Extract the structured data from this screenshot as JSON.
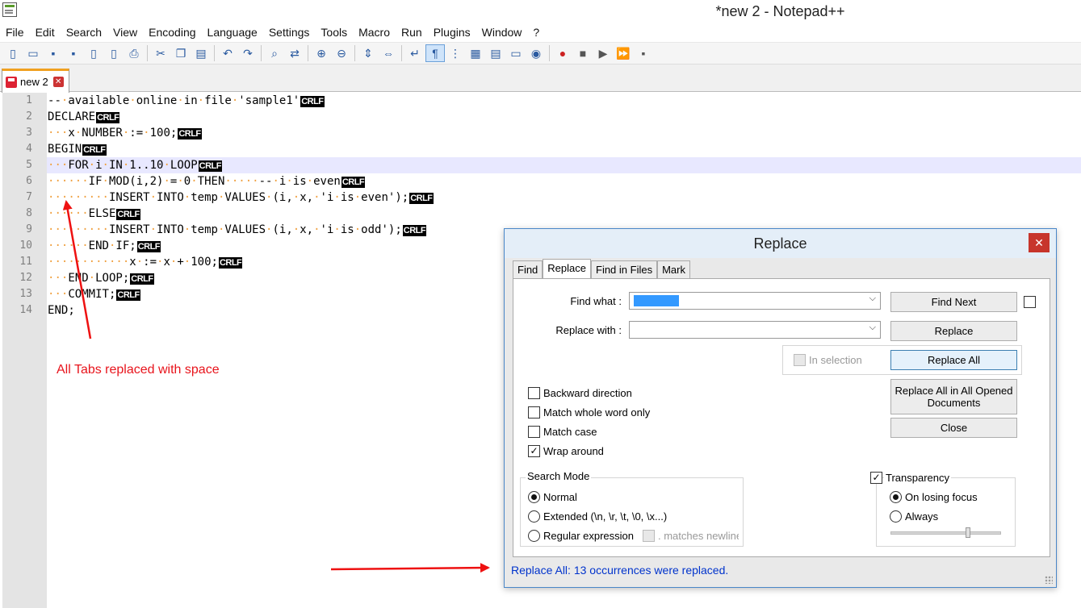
{
  "window": {
    "title": "*new 2 - Notepad++"
  },
  "menu": [
    "File",
    "Edit",
    "Search",
    "View",
    "Encoding",
    "Language",
    "Settings",
    "Tools",
    "Macro",
    "Run",
    "Plugins",
    "Window",
    "?"
  ],
  "toolbar": {
    "icons": [
      "new-file-icon",
      "open-file-icon",
      "save-icon",
      "save-all-icon",
      "close-icon",
      "close-all-icon",
      "print-icon",
      "cut-icon",
      "copy-icon",
      "paste-icon",
      "undo-icon",
      "redo-icon",
      "find-icon",
      "replace-icon",
      "zoom-in-icon",
      "zoom-out-icon",
      "sync-vertical-icon",
      "sync-horizontal-icon",
      "word-wrap-icon",
      "show-all-characters-icon",
      "indent-guide-icon",
      "document-map-icon",
      "function-list-icon",
      "folder-as-workspace-icon",
      "monitoring-icon",
      "record-macro-icon",
      "stop-record-icon",
      "play-macro-icon",
      "run-macro-multiple-icon",
      "save-macro-icon"
    ],
    "active_icon": "show-all-characters-icon"
  },
  "tab": {
    "label": "new 2",
    "close_glyph": "✕"
  },
  "editor": {
    "line_numbers": [
      "1",
      "2",
      "3",
      "4",
      "5",
      "6",
      "7",
      "8",
      "9",
      "10",
      "11",
      "12",
      "13",
      "14"
    ],
    "current_line": "5",
    "eol_marker": "CRLF",
    "whitespace_glyph": "·",
    "lines": [
      "-- available online in file 'sample1'",
      "DECLARE",
      "   x NUMBER := 100;",
      "BEGIN",
      "   FOR i IN 1..10 LOOP",
      "      IF MOD(i,2) = 0 THEN     -- i is even",
      "         INSERT INTO temp VALUES (i, x, 'i is even');",
      "      ELSE",
      "         INSERT INTO temp VALUES (i, x, 'i is odd');",
      "      END IF;",
      "            x := x + 100;",
      "   END LOOP;",
      "   COMMIT;",
      "END;"
    ]
  },
  "annotation": {
    "text": "All Tabs replaced with space",
    "color": "#e8141c"
  },
  "dialog": {
    "title": "Replace",
    "close_glyph": "✕",
    "tabs": [
      "Find",
      "Replace",
      "Find in Files",
      "Mark"
    ],
    "active_tab": "Replace",
    "find_label": "Find what :",
    "replace_label": "Replace with :",
    "find_value": "",
    "replace_value": "",
    "buttons": {
      "find_next": "Find Next",
      "replace": "Replace",
      "replace_all": "Replace All",
      "replace_all_opened": "Replace All in All Opened Documents",
      "close": "Close"
    },
    "in_selection": {
      "label": "In selection",
      "checked": false,
      "enabled": false
    },
    "options": [
      {
        "label": "Backward direction",
        "checked": false
      },
      {
        "label": "Match whole word only",
        "checked": false
      },
      {
        "label": "Match case",
        "checked": false
      },
      {
        "label": "Wrap around",
        "checked": true
      }
    ],
    "search_mode": {
      "title": "Search Mode",
      "options": [
        "Normal",
        "Extended (\\n, \\r, \\t, \\0, \\x...)",
        "Regular expression"
      ],
      "selected": "Normal",
      "matches_newline_label": ". matches newline"
    },
    "transparency": {
      "label": "Transparency",
      "checked": true,
      "options": [
        "On losing focus",
        "Always"
      ],
      "selected": "On losing focus",
      "level": 0.7
    },
    "status": "Replace All: 13 occurrences were replaced."
  }
}
